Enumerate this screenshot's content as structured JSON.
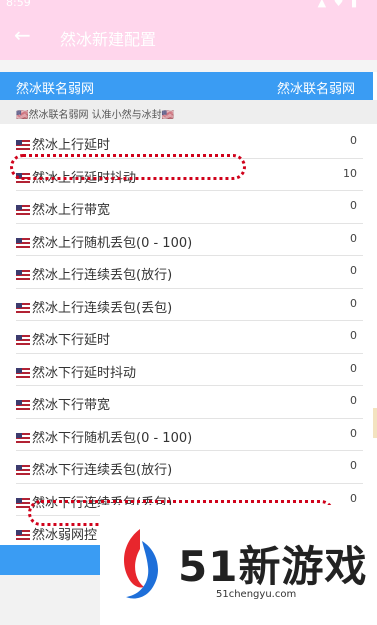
{
  "status": {
    "time": "8:59",
    "icons": "▲ ♥ ▮"
  },
  "appbar": {
    "title": "然冰新建配置"
  },
  "banner": {
    "left": "然冰联名弱网",
    "right": "然冰联名弱网"
  },
  "note": "🇺🇸然冰联名弱网 认准小然与冰封🇺🇸",
  "rows": [
    {
      "label": "然冰上行延时",
      "value": "0"
    },
    {
      "label": "然冰上行延时抖动",
      "value": "10"
    },
    {
      "label": "然冰上行带宽",
      "value": "0"
    },
    {
      "label": "然冰上行随机丢包(0 - 100)",
      "value": "0"
    },
    {
      "label": "然冰上行连续丢包(放行)",
      "value": "0"
    },
    {
      "label": "然冰上行连续丢包(丢包)",
      "value": "0"
    },
    {
      "label": "然冰下行延时",
      "value": "0"
    },
    {
      "label": "然冰下行延时抖动",
      "value": "0"
    },
    {
      "label": "然冰下行带宽",
      "value": "0"
    },
    {
      "label": "然冰下行随机丢包(0 - 100)",
      "value": "0"
    },
    {
      "label": "然冰下行连续丢包(放行)",
      "value": "0"
    },
    {
      "label": "然冰下行连续丢包(丢包)",
      "value": "0"
    },
    {
      "label": "然冰弱网控",
      "value": ""
    }
  ],
  "watermark": {
    "brand": "51新游戏",
    "site": "51chengyu.com"
  }
}
